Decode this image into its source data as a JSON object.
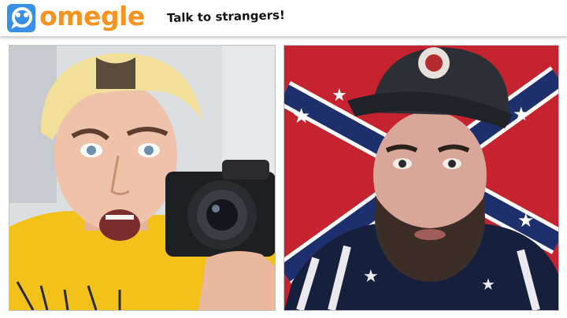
{
  "app": {
    "logo_text": "omegle",
    "tagline": "Talk to strangers!"
  },
  "icons": {
    "logo": "omegle-chat-bubble-icon"
  },
  "colors": {
    "brand_orange": "#f7931e",
    "logo_blue": "#3a8ee6"
  }
}
